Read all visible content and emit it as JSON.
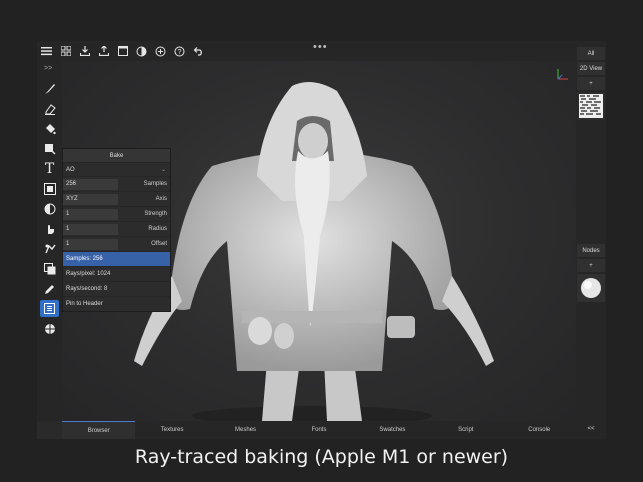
{
  "toolbar": {
    "icons": [
      "menu-icon",
      "grid-icon",
      "import-icon",
      "export-icon",
      "window-icon",
      "material-icon",
      "add-icon",
      "help-icon",
      "undo-icon"
    ],
    "more": "•••"
  },
  "tools": [
    "brush-icon",
    "eraser-icon",
    "fill-icon",
    "stamp-icon",
    "text-icon",
    "transform-icon",
    "mask-icon",
    "hand-icon",
    "clone-icon",
    "layers-icon",
    "eyedropper-icon",
    "bake-icon",
    "sphere-icon"
  ],
  "tools_collapse": ">>",
  "bake_panel": {
    "title": "Bake",
    "mode": "AO",
    "params": [
      {
        "value": "256",
        "label": "Samples"
      },
      {
        "value": "XYZ",
        "label": "Axis"
      },
      {
        "value": "1",
        "label": "Strength"
      },
      {
        "value": "1",
        "label": "Radius"
      },
      {
        "value": "1",
        "label": "Offset"
      }
    ],
    "stats": [
      "Samples: 256",
      "Rays/pixel: 1024",
      "Rays/second: 8"
    ],
    "pin": "Pin to Header"
  },
  "right_panel": {
    "filter": "All",
    "view2d": "2D View",
    "add1": "+",
    "nodes": "Nodes",
    "add2": "+",
    "collapse": "<<"
  },
  "bottom_tabs": [
    "Browser",
    "Textures",
    "Meshes",
    "Fonts",
    "Swatches",
    "Script",
    "Console"
  ],
  "selected_tab": "Browser",
  "caption": "Ray-traced baking (Apple M1 or newer)",
  "colors": {
    "accent": "#2f6fc7",
    "highlight": "#3762a8",
    "background": "#222223"
  }
}
